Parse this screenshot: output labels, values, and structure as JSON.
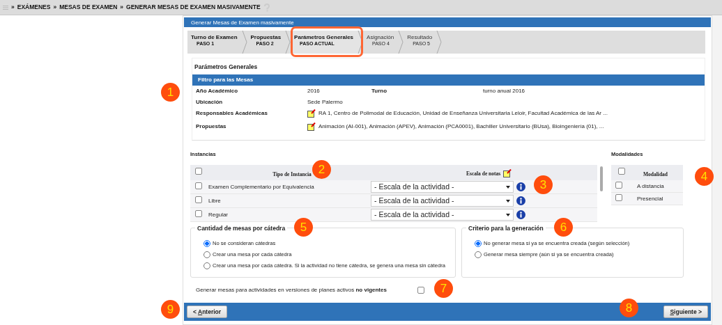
{
  "breadcrumb": {
    "separator": "»",
    "items": [
      "EXÁMENES",
      "MESAS DE EXAMEN",
      "GENERAR MESAS DE EXAMEN MASIVAMENTE"
    ]
  },
  "panel_title": "Generar Mesas de Examen masivamente",
  "steps": [
    {
      "label": "Turno de Examen",
      "sub": "PASO 1",
      "selected": false,
      "highlighted": false
    },
    {
      "label": "Propuestas",
      "sub": "PASO 2",
      "selected": false,
      "highlighted": false
    },
    {
      "label": "Parámetros Generales",
      "sub": "PASO ACTUAL",
      "selected": true,
      "highlighted": true
    },
    {
      "label": "Asignación",
      "sub": "PASO 4",
      "selected": false,
      "highlighted": false
    },
    {
      "label": "Resultado",
      "sub": "PASO 5",
      "selected": false,
      "highlighted": false
    }
  ],
  "section_title": "Parámetros Generales",
  "filter": {
    "title": "Filtro para las Mesas",
    "callout": "1",
    "rows": [
      {
        "kind": "pair",
        "label": "Año Académico",
        "value": "2016",
        "extra_label": "Turno",
        "extra_value": "turno anual 2016"
      },
      {
        "kind": "text",
        "label": "Ubicación",
        "value": "Sede Palermo"
      },
      {
        "kind": "note",
        "label": "Responsables Académicas",
        "value": "RA 1, Centro de Polimodal de Educación, Unidad de Enseñanza Universitaria Leloir, Facultad Académica de las Ar ..."
      },
      {
        "kind": "note",
        "label": "Propuestas",
        "value": "Animación (AI-001), Animación (APEV), Animación (PCA0001), Bachiller Universitario (BUsa), Bioingeniería (01), ..."
      }
    ]
  },
  "instancias": {
    "title": "Instancias",
    "header_checked": false,
    "columns": [
      "Tipo de Instancia",
      "Escala de notas"
    ],
    "callout_type": "2",
    "callout_info": "3",
    "rows": [
      {
        "label": "Examen Complementario por Equivalencia",
        "checked": false,
        "scale": "- Escala de la actividad -"
      },
      {
        "label": "Libre",
        "checked": false,
        "scale": "- Escala de la actividad -"
      },
      {
        "label": "Regular",
        "checked": false,
        "scale": "- Escala de la actividad -"
      }
    ]
  },
  "modalidades": {
    "title": "Modalidades",
    "header_checked": false,
    "column": "Modalidad",
    "callout": "4",
    "rows": [
      {
        "label": "A distancia",
        "checked": false
      },
      {
        "label": "Presencial",
        "checked": false
      }
    ]
  },
  "cantidad": {
    "title": "Cantidad de mesas por cátedra",
    "callout": "5",
    "options": [
      {
        "label": "No se consideran cátedras",
        "selected": true
      },
      {
        "label": "Crear una mesa por cada cátedra",
        "selected": false
      },
      {
        "label": "Crear una mesa por cada cátedra. Si la actividad no tiene cátedra, se genera una mesa sin cátedra",
        "selected": false
      }
    ]
  },
  "criterio": {
    "title": "Criterio para la generación",
    "callout": "6",
    "options": [
      {
        "label": "No generar mesa si ya se encuentra creada (según selección)",
        "selected": true
      },
      {
        "label": "Generar mesa siempre (aún si ya se encuentra creada)",
        "selected": false
      }
    ]
  },
  "no_vigentes": {
    "label": "Generar mesas para actividades en versiones de planes activos **no vigentes**",
    "checked": false,
    "callout": "7"
  },
  "anterior": {
    "before": "< ",
    "accesskey": "A",
    "after": "nterior",
    "callout": "9"
  },
  "siguiente": {
    "accesskey": "S",
    "after": "iguiente >",
    "callout": "8"
  }
}
